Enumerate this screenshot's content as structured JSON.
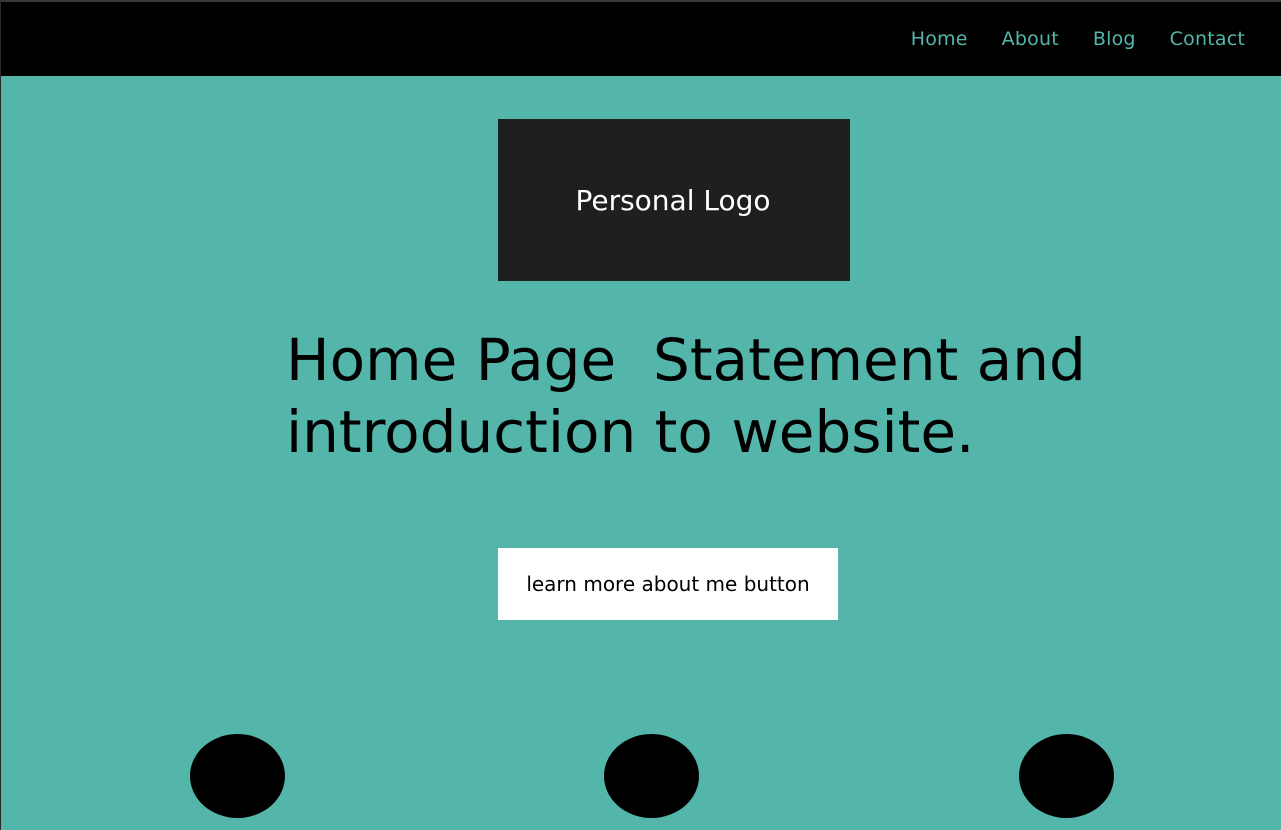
{
  "nav": {
    "items": [
      {
        "label": "Home"
      },
      {
        "label": "About"
      },
      {
        "label": "Blog"
      },
      {
        "label": "Contact"
      }
    ]
  },
  "hero": {
    "logo_label": "Personal Logo",
    "headline": "Home Page  Statement and introduction to website.",
    "cta_label": "learn more about me button"
  },
  "colors": {
    "page_background": "#54b6ab",
    "nav_background": "#000000",
    "nav_link": "#54b6ab",
    "logo_box": "#1f1f1f",
    "button_background": "#ffffff",
    "circle": "#000000"
  },
  "features": {
    "placeholders": [
      {
        "icon": "circle-placeholder"
      },
      {
        "icon": "circle-placeholder"
      },
      {
        "icon": "circle-placeholder"
      }
    ]
  }
}
